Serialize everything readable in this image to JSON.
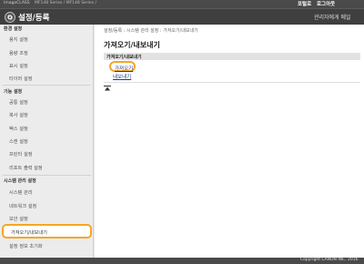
{
  "topbar": {
    "brand": "ImageCLASS",
    "device_name": "MF148 Series / MF148 Series /",
    "portal": "포털로",
    "logout": "로그아웃"
  },
  "titlebar": {
    "icon": "gear-icon",
    "title": "설정/등록",
    "admin_mail": "관리자에게 메일"
  },
  "sidebar": {
    "sections": [
      {
        "label": "환경 설정",
        "items": [
          "용지 설정",
          "용량 조정",
          "표시 설정",
          "타이머 설정"
        ]
      },
      {
        "label": "기능 설정",
        "items": [
          "공통 설정",
          "복사 설정",
          "팩스 설정",
          "스캔 설정",
          "프린터 설정",
          "리포트 출력 설정"
        ]
      },
      {
        "label": "시스템 관리 설정",
        "items": [
          "시스템 관리",
          "네트워크 설정",
          "보안 설정",
          "가져오기/내보내기",
          "설정 정보 초기화"
        ]
      }
    ],
    "active_item": "가져오기/내보내기"
  },
  "main": {
    "breadcrumb": "설정/등록 : 시스템 관리 설정 : 가져오기/내보내기",
    "heading": "가져오기/내보내기",
    "box_header": "가져오기/내보내기",
    "import_link": "가져오기",
    "export_link": "내보내기",
    "top_icon": "page-top-icon"
  },
  "footer": {
    "copyright": "Copyright CANON INC. 2016"
  },
  "colors": {
    "highlight": "#f5a623",
    "link": "#1a3f8a",
    "header_bg": "#3f3f3f"
  }
}
